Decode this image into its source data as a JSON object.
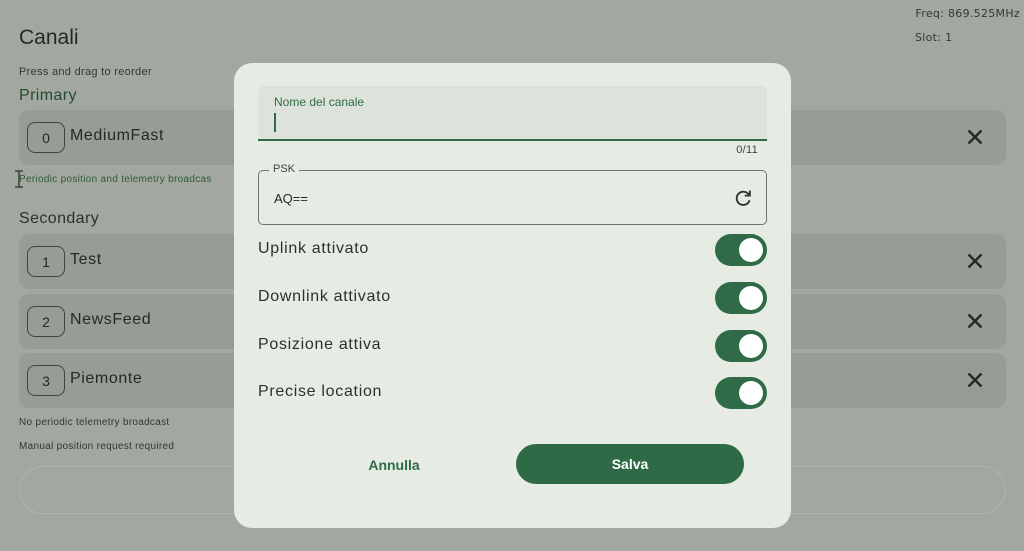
{
  "header": {
    "title": "Canali",
    "freq": "Freq: 869.525MHz",
    "slot": "Slot: 1"
  },
  "hint": "Press and drag to reorder",
  "primary": {
    "heading": "Primary",
    "channel": {
      "index": "0",
      "name": "MediumFast"
    },
    "note": "Periodic position and telemetry broadcas"
  },
  "secondary": {
    "heading": "Secondary",
    "channels": [
      {
        "index": "1",
        "name": "Test"
      },
      {
        "index": "2",
        "name": "NewsFeed"
      },
      {
        "index": "3",
        "name": "Piemonte"
      }
    ],
    "note1": "No periodic telemetry broadcast",
    "note2": "Manual position request required"
  },
  "dialog": {
    "name_label": "Nome del canale",
    "name_value": "",
    "counter": "0/11",
    "psk_label": "PSK",
    "psk_value": "AQ==",
    "toggles": [
      {
        "label": "Uplink attivato",
        "on": true
      },
      {
        "label": "Downlink attivato",
        "on": true
      },
      {
        "label": "Posizione attiva",
        "on": true
      },
      {
        "label": "Precise location",
        "on": true
      }
    ],
    "cancel_label": "Annulla",
    "save_label": "Salva"
  },
  "icons": {
    "delete": "close-icon",
    "refresh": "refresh-icon",
    "cursor": "text-cursor-icon"
  },
  "colors": {
    "accent": "#2f6b46",
    "scrim": "#a2a79f",
    "dialog_bg": "#e6ebe4"
  }
}
